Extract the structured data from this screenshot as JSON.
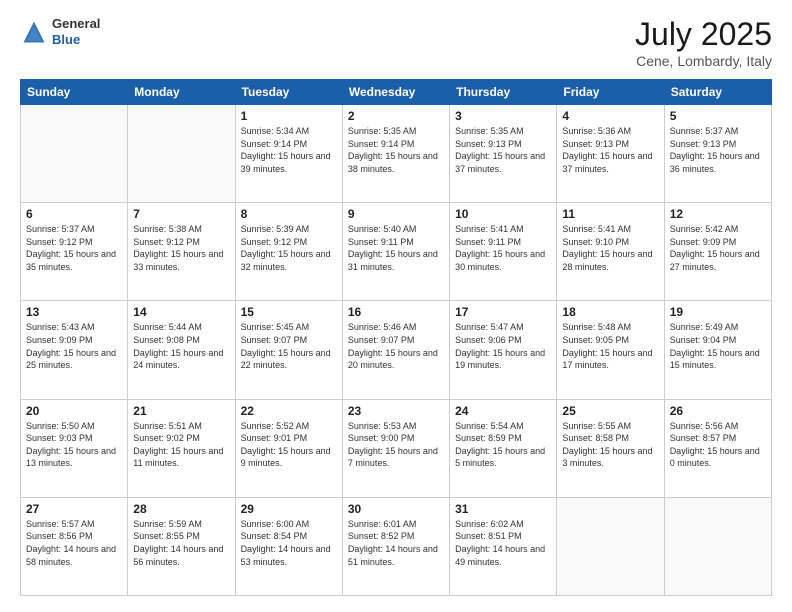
{
  "header": {
    "logo_general": "General",
    "logo_blue": "Blue",
    "month_title": "July 2025",
    "location": "Cene, Lombardy, Italy"
  },
  "days_of_week": [
    "Sunday",
    "Monday",
    "Tuesday",
    "Wednesday",
    "Thursday",
    "Friday",
    "Saturday"
  ],
  "weeks": [
    [
      {
        "day": "",
        "info": ""
      },
      {
        "day": "",
        "info": ""
      },
      {
        "day": "1",
        "info": "Sunrise: 5:34 AM\nSunset: 9:14 PM\nDaylight: 15 hours and 39 minutes."
      },
      {
        "day": "2",
        "info": "Sunrise: 5:35 AM\nSunset: 9:14 PM\nDaylight: 15 hours and 38 minutes."
      },
      {
        "day": "3",
        "info": "Sunrise: 5:35 AM\nSunset: 9:13 PM\nDaylight: 15 hours and 37 minutes."
      },
      {
        "day": "4",
        "info": "Sunrise: 5:36 AM\nSunset: 9:13 PM\nDaylight: 15 hours and 37 minutes."
      },
      {
        "day": "5",
        "info": "Sunrise: 5:37 AM\nSunset: 9:13 PM\nDaylight: 15 hours and 36 minutes."
      }
    ],
    [
      {
        "day": "6",
        "info": "Sunrise: 5:37 AM\nSunset: 9:12 PM\nDaylight: 15 hours and 35 minutes."
      },
      {
        "day": "7",
        "info": "Sunrise: 5:38 AM\nSunset: 9:12 PM\nDaylight: 15 hours and 33 minutes."
      },
      {
        "day": "8",
        "info": "Sunrise: 5:39 AM\nSunset: 9:12 PM\nDaylight: 15 hours and 32 minutes."
      },
      {
        "day": "9",
        "info": "Sunrise: 5:40 AM\nSunset: 9:11 PM\nDaylight: 15 hours and 31 minutes."
      },
      {
        "day": "10",
        "info": "Sunrise: 5:41 AM\nSunset: 9:11 PM\nDaylight: 15 hours and 30 minutes."
      },
      {
        "day": "11",
        "info": "Sunrise: 5:41 AM\nSunset: 9:10 PM\nDaylight: 15 hours and 28 minutes."
      },
      {
        "day": "12",
        "info": "Sunrise: 5:42 AM\nSunset: 9:09 PM\nDaylight: 15 hours and 27 minutes."
      }
    ],
    [
      {
        "day": "13",
        "info": "Sunrise: 5:43 AM\nSunset: 9:09 PM\nDaylight: 15 hours and 25 minutes."
      },
      {
        "day": "14",
        "info": "Sunrise: 5:44 AM\nSunset: 9:08 PM\nDaylight: 15 hours and 24 minutes."
      },
      {
        "day": "15",
        "info": "Sunrise: 5:45 AM\nSunset: 9:07 PM\nDaylight: 15 hours and 22 minutes."
      },
      {
        "day": "16",
        "info": "Sunrise: 5:46 AM\nSunset: 9:07 PM\nDaylight: 15 hours and 20 minutes."
      },
      {
        "day": "17",
        "info": "Sunrise: 5:47 AM\nSunset: 9:06 PM\nDaylight: 15 hours and 19 minutes."
      },
      {
        "day": "18",
        "info": "Sunrise: 5:48 AM\nSunset: 9:05 PM\nDaylight: 15 hours and 17 minutes."
      },
      {
        "day": "19",
        "info": "Sunrise: 5:49 AM\nSunset: 9:04 PM\nDaylight: 15 hours and 15 minutes."
      }
    ],
    [
      {
        "day": "20",
        "info": "Sunrise: 5:50 AM\nSunset: 9:03 PM\nDaylight: 15 hours and 13 minutes."
      },
      {
        "day": "21",
        "info": "Sunrise: 5:51 AM\nSunset: 9:02 PM\nDaylight: 15 hours and 11 minutes."
      },
      {
        "day": "22",
        "info": "Sunrise: 5:52 AM\nSunset: 9:01 PM\nDaylight: 15 hours and 9 minutes."
      },
      {
        "day": "23",
        "info": "Sunrise: 5:53 AM\nSunset: 9:00 PM\nDaylight: 15 hours and 7 minutes."
      },
      {
        "day": "24",
        "info": "Sunrise: 5:54 AM\nSunset: 8:59 PM\nDaylight: 15 hours and 5 minutes."
      },
      {
        "day": "25",
        "info": "Sunrise: 5:55 AM\nSunset: 8:58 PM\nDaylight: 15 hours and 3 minutes."
      },
      {
        "day": "26",
        "info": "Sunrise: 5:56 AM\nSunset: 8:57 PM\nDaylight: 15 hours and 0 minutes."
      }
    ],
    [
      {
        "day": "27",
        "info": "Sunrise: 5:57 AM\nSunset: 8:56 PM\nDaylight: 14 hours and 58 minutes."
      },
      {
        "day": "28",
        "info": "Sunrise: 5:59 AM\nSunset: 8:55 PM\nDaylight: 14 hours and 56 minutes."
      },
      {
        "day": "29",
        "info": "Sunrise: 6:00 AM\nSunset: 8:54 PM\nDaylight: 14 hours and 53 minutes."
      },
      {
        "day": "30",
        "info": "Sunrise: 6:01 AM\nSunset: 8:52 PM\nDaylight: 14 hours and 51 minutes."
      },
      {
        "day": "31",
        "info": "Sunrise: 6:02 AM\nSunset: 8:51 PM\nDaylight: 14 hours and 49 minutes."
      },
      {
        "day": "",
        "info": ""
      },
      {
        "day": "",
        "info": ""
      }
    ]
  ]
}
